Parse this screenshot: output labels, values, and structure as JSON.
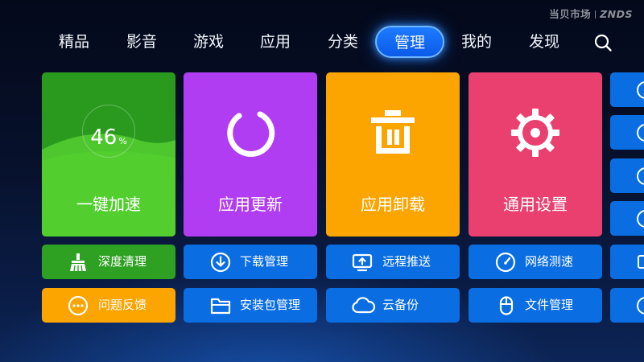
{
  "watermark": {
    "brand": "当贝市场",
    "site": "ZNDS"
  },
  "nav": {
    "items": [
      "精品",
      "影音",
      "游戏",
      "应用",
      "分类",
      "管理",
      "我的",
      "发现"
    ],
    "active": "管理"
  },
  "tiles": {
    "speed": {
      "label": "一键加速",
      "percent": "46",
      "unit": "%"
    },
    "update": {
      "label": "应用更新"
    },
    "uninstall": {
      "label": "应用卸载"
    },
    "settings": {
      "label": "通用设置"
    }
  },
  "buttons": {
    "deep_clean": "深度清理",
    "download_manager": "下载管理",
    "remote_push": "远程推送",
    "network_speed": "网络测速",
    "feedback": "问题反馈",
    "package_manager": "安装包管理",
    "cloud_backup": "云备份",
    "file_manager": "文件管理"
  },
  "icons": {
    "search": "search-icon",
    "speed": "speed-gauge-icon",
    "update": "refresh-icon",
    "uninstall": "trash-icon",
    "settings": "gear-icon",
    "deep_clean": "broom-icon",
    "download_manager": "download-icon",
    "remote_push": "monitor-upload-icon",
    "network_speed": "speedometer-icon",
    "feedback": "chat-dots-icon",
    "package_manager": "folder-icon",
    "cloud_backup": "cloud-icon",
    "file_manager": "mouse-icon"
  },
  "colors": {
    "nav_active": "#1d7bff",
    "speed_tile": "#2a9a1f",
    "update_tile": "#b13df3",
    "uninstall_tile": "#fca400",
    "settings_tile": "#e9406f",
    "button_blue": "#0a6ee2",
    "button_green": "#2ea123",
    "button_orange": "#fca400"
  }
}
